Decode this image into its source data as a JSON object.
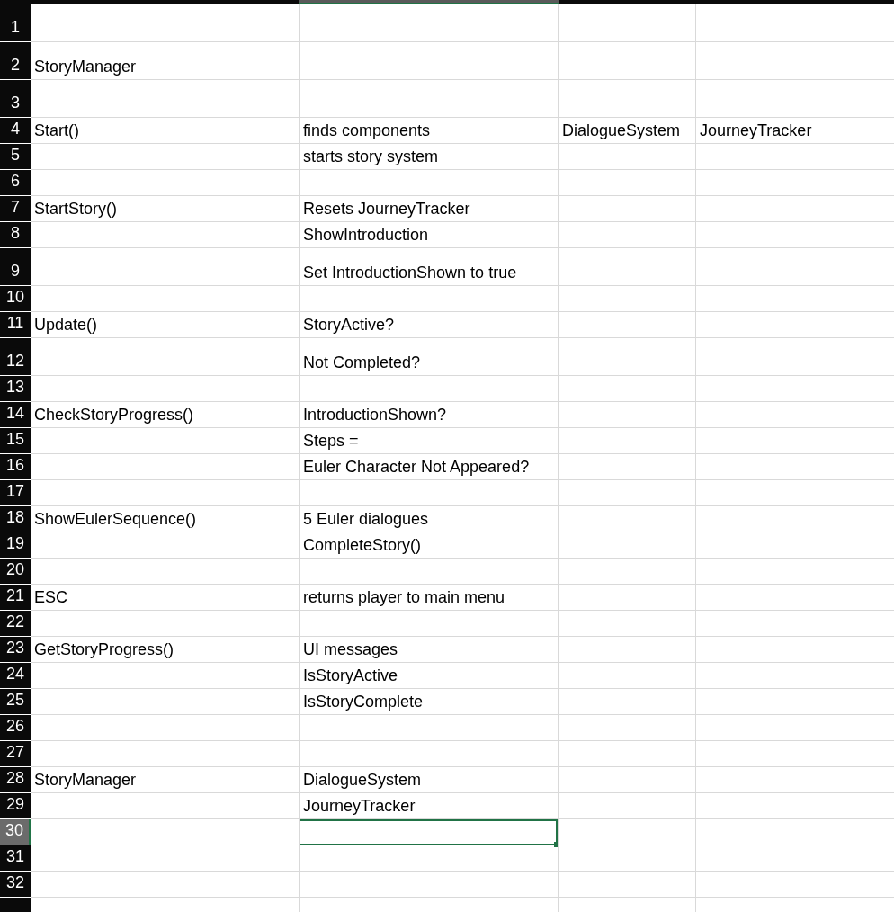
{
  "rows": [
    {
      "number": "1",
      "selected": false
    },
    {
      "number": "2",
      "selected": false,
      "a": "StoryManager"
    },
    {
      "number": "3",
      "selected": false
    },
    {
      "number": "4",
      "selected": false,
      "a": "Start()",
      "b": "finds components",
      "c": "DialogueSystem",
      "d": "JourneyTracker"
    },
    {
      "number": "5",
      "selected": false,
      "b": "starts story system"
    },
    {
      "number": "6",
      "selected": false
    },
    {
      "number": "7",
      "selected": false,
      "a": "StartStory()",
      "b": "Resets JourneyTracker"
    },
    {
      "number": "8",
      "selected": false,
      "b": "ShowIntroduction"
    },
    {
      "number": "9",
      "selected": false,
      "b": "Set IntroductionShown to true"
    },
    {
      "number": "10",
      "selected": false
    },
    {
      "number": "11",
      "selected": false,
      "a": "Update()",
      "b": "StoryActive?"
    },
    {
      "number": "12",
      "selected": false,
      "b": "Not Completed?"
    },
    {
      "number": "13",
      "selected": false
    },
    {
      "number": "14",
      "selected": false,
      "a": "CheckStoryProgress()",
      "b": "IntroductionShown?"
    },
    {
      "number": "15",
      "selected": false,
      "b": "Steps ="
    },
    {
      "number": "16",
      "selected": false,
      "b": "Euler Character Not Appeared?"
    },
    {
      "number": "17",
      "selected": false
    },
    {
      "number": "18",
      "selected": false,
      "a": "ShowEulerSequence()",
      "b": "5 Euler dialogues"
    },
    {
      "number": "19",
      "selected": false,
      "b": "CompleteStory()"
    },
    {
      "number": "20",
      "selected": false
    },
    {
      "number": "21",
      "selected": false,
      "a": "ESC",
      "b": "returns player to main menu"
    },
    {
      "number": "22",
      "selected": false
    },
    {
      "number": "23",
      "selected": false,
      "a": "GetStoryProgress()",
      "b": "UI messages"
    },
    {
      "number": "24",
      "selected": false,
      "b": "IsStoryActive"
    },
    {
      "number": "25",
      "selected": false,
      "b": "IsStoryComplete"
    },
    {
      "number": "26",
      "selected": false
    },
    {
      "number": "27",
      "selected": false
    },
    {
      "number": "28",
      "selected": false,
      "a": "StoryManager",
      "b": "DialogueSystem"
    },
    {
      "number": "29",
      "selected": false,
      "b": "JourneyTracker"
    },
    {
      "number": "30",
      "selected": true
    },
    {
      "number": "31",
      "selected": false
    },
    {
      "number": "32",
      "selected": false
    },
    {
      "selected": false
    }
  ]
}
